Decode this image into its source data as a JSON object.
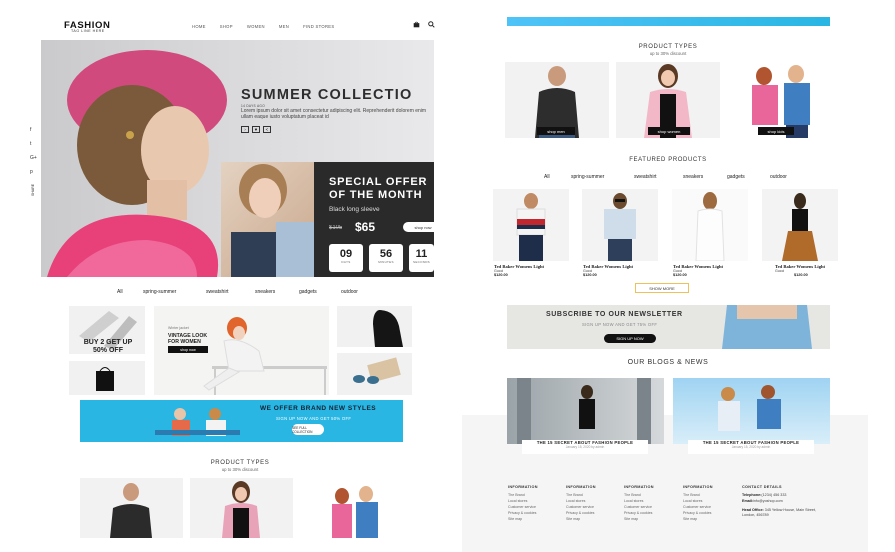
{
  "header": {
    "logo": "FASHION",
    "tagline": "TAG LINE HERE",
    "nav": [
      "HOME",
      "SHOP",
      "WOMEN",
      "MEN",
      "FIND STORES"
    ],
    "icons": [
      "bag-icon",
      "search-icon"
    ]
  },
  "hero": {
    "title": "SUMMER COLLECTIO",
    "small": "14 DAYS AGO",
    "desc": "Lorem ipsum dolor sit amet consectetur adipiscing elit. Reprehenderit dolorem enim ullam eaque iusto voluptatum placeat id",
    "social": [
      "f",
      "t",
      "G+",
      "p"
    ],
    "share_label": "SHARE",
    "controls": [
      "›",
      "♥",
      "<"
    ]
  },
  "promo": {
    "title": "SPECIAL OFFER OF THE MONTH",
    "subtitle": "Black long sleeve",
    "old_price": "$105",
    "new_price": "$65",
    "button": "shop now",
    "countdown": [
      {
        "value": "09",
        "label": "DAYS"
      },
      {
        "value": "56",
        "label": "MINUTES"
      },
      {
        "value": "11",
        "label": "SECONDS"
      }
    ]
  },
  "filters": [
    "All",
    "spring-summer",
    "sweatshirt",
    "sneakers",
    "gadgets",
    "outdoor"
  ],
  "categories": {
    "deal": "BUY 2 GET UP 50% OFF",
    "vintage_small": "Winter jacket",
    "vintage_title": "VINTAGE LOOK FOR WOMEN",
    "vintage_btn": "shop now"
  },
  "banner": {
    "heading": "WE OFFER BRAND NEW STYLES",
    "sub": "SIGN UP NOW AND GET 50% OFF",
    "button": "SEE FULL COLLECTION"
  },
  "product_types": {
    "title": "PRODUCT TYPES",
    "sub": "up to 30% discount",
    "items": [
      {
        "button": "shop men"
      },
      {
        "button": "shop women"
      },
      {
        "button": "shop kids"
      }
    ]
  },
  "featured": {
    "title": "FEATURED PRODUCTS",
    "filters": [
      "All",
      "spring-summer",
      "sweatshirt",
      "sneakers",
      "gadgets",
      "outdoor"
    ],
    "products": [
      {
        "name": "Ted Baker Womens Light",
        "brand": "Gucci",
        "price": "$120.00"
      },
      {
        "name": "Ted Baker Womens Light",
        "brand": "Gucci",
        "price": "$120.00"
      },
      {
        "name": "Ted Baker Womens Light",
        "brand": "Gucci",
        "price": "$120.00"
      },
      {
        "name": "Ted Baker Womens Light",
        "brand": "Gucci",
        "price": "$120.00"
      }
    ],
    "show_more": "SHOW MORE"
  },
  "newsletter": {
    "heading": "SUBSCRIBE TO OUR NEWSLETTER",
    "sub": "SIGN UP NOW AND GET 75% OFF",
    "button": "SIGN UP NOW"
  },
  "blogs": {
    "title": "OUR BLOGS & NEWS",
    "posts": [
      {
        "title": "THE 15 SECRET ABOUT FASHION PEOPLE",
        "meta": "January 15, 2020 by admin"
      },
      {
        "title": "THE 15 SECRET ABOUT FASHION PEOPLE",
        "meta": "January 15, 2020 by admin"
      }
    ]
  },
  "footer": {
    "columns": [
      {
        "heading": "INFORMATION",
        "items": [
          "The Brand",
          "Local stores",
          "Customer service",
          "Privacy & cookies",
          "Site map"
        ]
      },
      {
        "heading": "INFORMATION",
        "items": [
          "The Brand",
          "Local stores",
          "Customer service",
          "Privacy & cookies",
          "Site map"
        ]
      },
      {
        "heading": "INFORMATION",
        "items": [
          "The Brand",
          "Local stores",
          "Customer service",
          "Privacy & cookies",
          "Site map"
        ]
      },
      {
        "heading": "INFORMATION",
        "items": [
          "The Brand",
          "Local stores",
          "Customer service",
          "Privacy & cookies",
          "Site map"
        ]
      }
    ],
    "contact": {
      "heading": "CONTACT DETAILS",
      "tel_label": "Telephone:",
      "tel": "(1234) 456 333",
      "email_label": "Email:",
      "email": "info@yoshop.com",
      "office_label": "Head Office:",
      "office": "345 Yellow House, Main Street, London, 456789"
    }
  },
  "colors": {
    "accent_blue": "#29b6e3",
    "dark": "#1e1e1e",
    "gold": "#f0c15a"
  }
}
